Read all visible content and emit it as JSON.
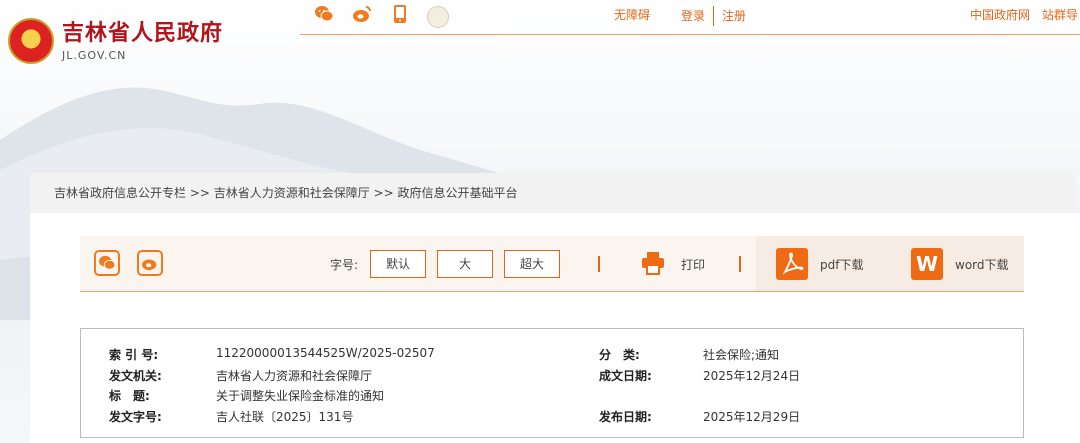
{
  "header": {
    "site_title": "吉林省人民政府",
    "site_domain": "JL.GOV.CN",
    "accessibility": "无障碍",
    "login": "登录",
    "register": "注册",
    "central_gov": "中国政府网",
    "site_group": "站群导"
  },
  "social_icons": [
    "wechat-icon",
    "weibo-icon",
    "mobile-icon",
    "assistant-avatar-icon"
  ],
  "breadcrumb": {
    "text": "吉林省政府信息公开专栏 >> 吉林省人力资源和社会保障厅 >> 政府信息公开基础平台"
  },
  "toolbar": {
    "font_size_label": "字号:",
    "font_default": "默认",
    "font_large": "大",
    "font_xlarge": "超大",
    "print": "打印",
    "pdf_download": "pdf下载",
    "word_download": "word下载",
    "word_icon_letter": "W"
  },
  "meta": {
    "index_label": "索 引 号:",
    "index_value": "11220000013544525W/2025-02507",
    "category_label": "分　类:",
    "category_value": "社会保险;通知",
    "issuer_label": "发文机关:",
    "issuer_value": "吉林省人力资源和社会保障厅",
    "created_label": "成文日期:",
    "created_value": "2025年12月24日",
    "title_label": "标　题:",
    "title_value": "关于调整失业保险金标准的通知",
    "docno_label": "发文字号:",
    "docno_value": "吉人社联〔2025〕131号",
    "published_label": "发布日期:",
    "published_value": "2025年12月29日"
  },
  "colors": {
    "accent": "#e26518",
    "brand_red": "#b3141b"
  }
}
